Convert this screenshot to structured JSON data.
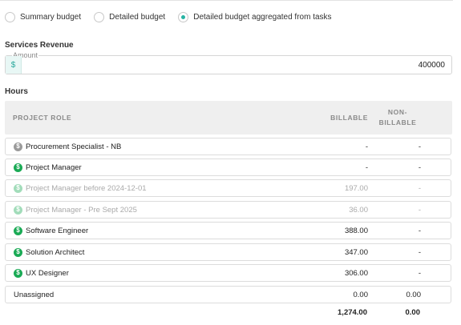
{
  "budget_mode": {
    "options": [
      {
        "label": "Summary budget",
        "checked": false
      },
      {
        "label": "Detailed budget",
        "checked": false
      },
      {
        "label": "Detailed budget aggregated from tasks",
        "checked": true
      }
    ]
  },
  "services_revenue": {
    "title": "Services Revenue",
    "amount_label": "Amount",
    "currency_symbol": "$",
    "amount_value": "400000"
  },
  "hours": {
    "title": "Hours",
    "columns": {
      "role": "PROJECT ROLE",
      "billable": "BILLABLE",
      "nonbillable_line1": "NON-",
      "nonbillable_line2": "BILLABLE"
    },
    "rows": [
      {
        "role": "Procurement Specialist - NB",
        "billable": "-",
        "nonbillable": "-",
        "icon": "dollar-gray-icon",
        "dimmed": false
      },
      {
        "role": "Project Manager",
        "billable": "-",
        "nonbillable": "-",
        "icon": "dollar-green-icon",
        "dimmed": false
      },
      {
        "role": "Project Manager before 2024-12-01",
        "billable": "197.00",
        "nonbillable": "-",
        "icon": "dollar-green-icon",
        "dimmed": true
      },
      {
        "role": "Project Manager - Pre Sept 2025",
        "billable": "36.00",
        "nonbillable": "-",
        "icon": "dollar-green-icon",
        "dimmed": true
      },
      {
        "role": "Software Engineer",
        "billable": "388.00",
        "nonbillable": "-",
        "icon": "dollar-green-icon",
        "dimmed": false
      },
      {
        "role": "Solution Architect",
        "billable": "347.00",
        "nonbillable": "-",
        "icon": "dollar-green-icon",
        "dimmed": false
      },
      {
        "role": "UX Designer",
        "billable": "306.00",
        "nonbillable": "-",
        "icon": "dollar-green-icon",
        "dimmed": false
      },
      {
        "role": "Unassigned",
        "billable": "0.00",
        "nonbillable": "0.00",
        "icon": "",
        "dimmed": false
      }
    ],
    "totals": {
      "billable": "1,274.00",
      "nonbillable": "0.00"
    }
  },
  "colors": {
    "accent": "#26b3a3",
    "billable_icon": "#1aaa55",
    "nonbillable_icon": "#9a9a9a"
  }
}
